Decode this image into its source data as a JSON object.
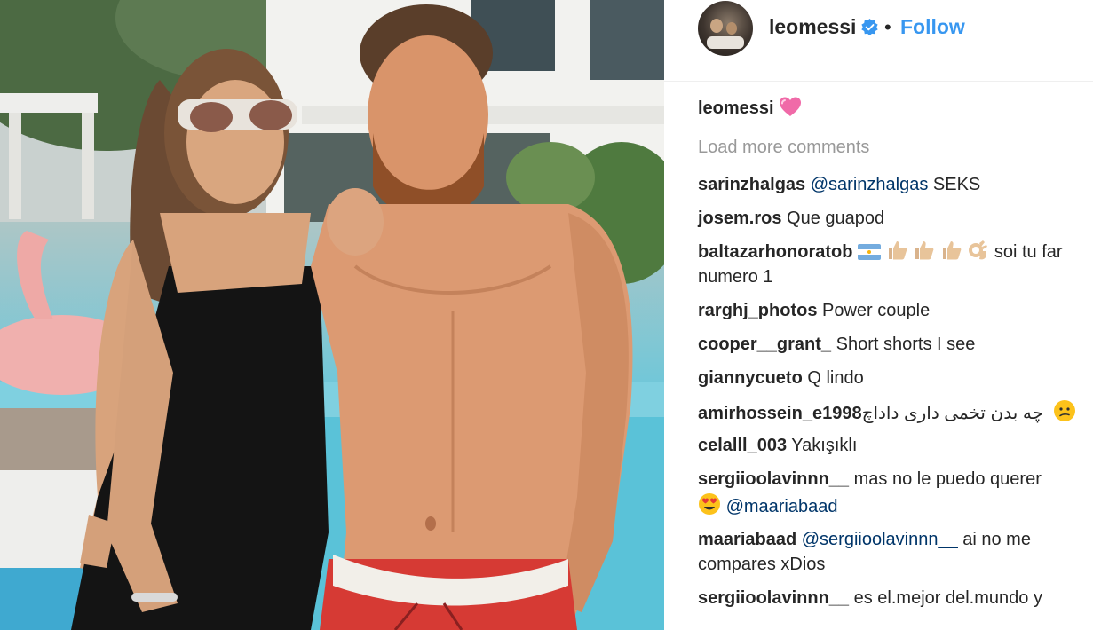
{
  "post": {
    "header": {
      "username": "leomessi",
      "separator": "•",
      "follow_label": "Follow"
    },
    "caption": {
      "username": "leomessi",
      "emoji": "pink-heart"
    },
    "load_more_label": "Load more comments",
    "comments": [
      {
        "username": "sarinzhalgas",
        "mention": "@sarinzhalgas",
        "text": " SEKS"
      },
      {
        "username": "josem.ros",
        "text": " Que guapod"
      },
      {
        "username": "baltazarhonoratob",
        "emojis": [
          "argentina-flag",
          "thumbs-up",
          "thumbs-up",
          "thumbs-up",
          "ok-hand"
        ],
        "text": " soi tu far",
        "text2": "numero 1"
      },
      {
        "username": "rarghj_photos",
        "text": " Power couple"
      },
      {
        "username": "cooper__grant_",
        "text": " Short shorts I see"
      },
      {
        "username": "giannycueto",
        "text": " Q lindo"
      },
      {
        "username": "amirhossein_e1998",
        "text": " چه بدن تخمی داری داداچ",
        "emoji": "confused-face"
      },
      {
        "username": "celalll_003",
        "text": " Yakışıklı"
      },
      {
        "username": "sergiioolavinnn__",
        "text": " mas no le puedo querer",
        "emoji": "heart-eyes-face",
        "mention2": " @maariabaad"
      },
      {
        "username": "maariabaad",
        "mention": " @sergiioolavinnn__",
        "text": " ai no me",
        "text2": "compares xDios"
      },
      {
        "username": "sergiioolavinnn__",
        "text": " es el.mejor del.mundo y"
      }
    ]
  }
}
